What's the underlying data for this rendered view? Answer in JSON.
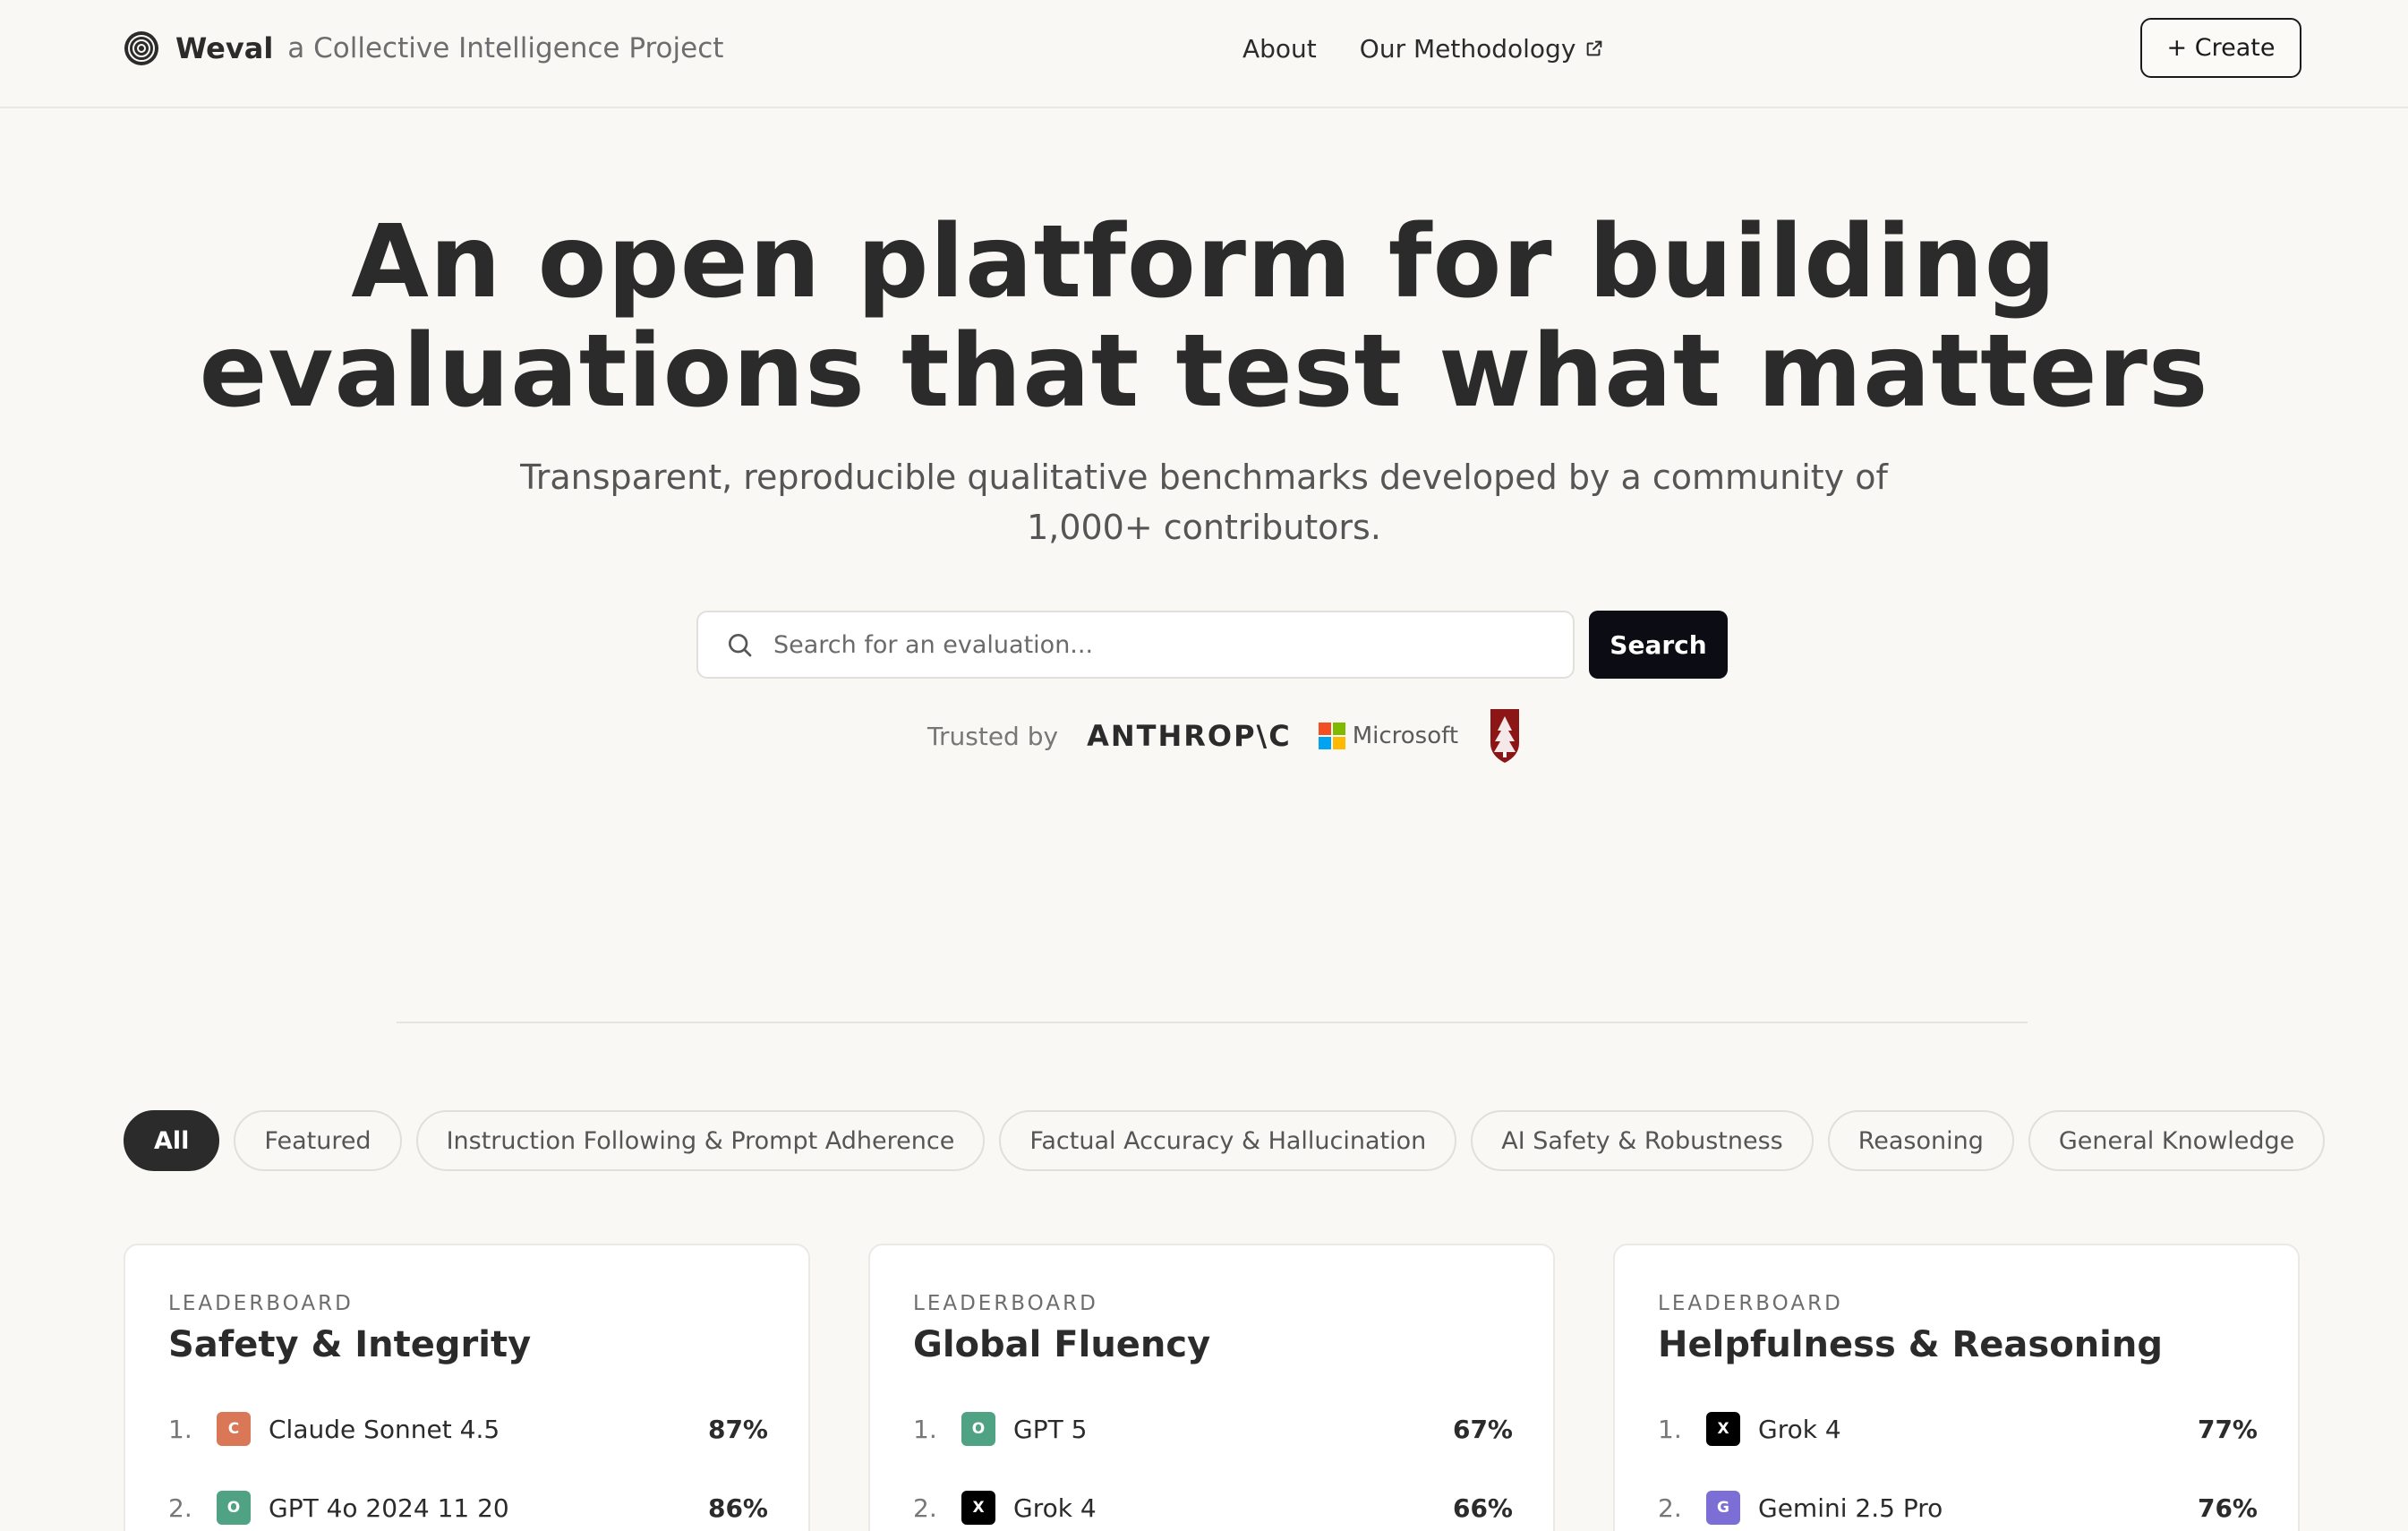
{
  "header": {
    "brand_name": "Weval",
    "brand_tagline": "a Collective Intelligence Project",
    "nav": [
      {
        "label": "About"
      },
      {
        "label": "Our Methodology"
      }
    ],
    "create_label": "+ Create"
  },
  "hero": {
    "title_line1": "An open platform for building",
    "title_line2": "evaluations that test what matters",
    "subtitle": "Transparent, reproducible qualitative benchmarks developed by a community of 1,000+ contributors."
  },
  "search": {
    "placeholder": "Search for an evaluation...",
    "button_label": "Search"
  },
  "trusted": {
    "label": "Trusted by",
    "anthropic": "ANTHROP\\C",
    "microsoft": "Microsoft",
    "microsoft_colors": [
      "#f25022",
      "#7fba00",
      "#00a4ef",
      "#ffb900"
    ],
    "stanford_color": "#8c1515"
  },
  "filters": [
    {
      "label": "All",
      "active": true
    },
    {
      "label": "Featured"
    },
    {
      "label": "Instruction Following & Prompt Adherence"
    },
    {
      "label": "Factual Accuracy & Hallucination"
    },
    {
      "label": "AI Safety & Robustness"
    },
    {
      "label": "Reasoning"
    },
    {
      "label": "General Knowledge"
    }
  ],
  "leaderboards": [
    {
      "eyebrow": "LEADERBOARD",
      "title": "Safety & Integrity",
      "rows": [
        {
          "rank": "1.",
          "badge": "C",
          "badge_color": "#d97757",
          "name": "Claude Sonnet 4.5",
          "score": "87%"
        },
        {
          "rank": "2.",
          "badge": "O",
          "badge_color": "#4fa284",
          "name": "GPT 4o 2024 11 20",
          "score": "86%"
        }
      ]
    },
    {
      "eyebrow": "LEADERBOARD",
      "title": "Global Fluency",
      "rows": [
        {
          "rank": "1.",
          "badge": "O",
          "badge_color": "#4fa284",
          "name": "GPT 5",
          "score": "67%"
        },
        {
          "rank": "2.",
          "badge": "X",
          "badge_color": "#000000",
          "name": "Grok 4",
          "score": "66%"
        }
      ]
    },
    {
      "eyebrow": "LEADERBOARD",
      "title": "Helpfulness & Reasoning",
      "rows": [
        {
          "rank": "1.",
          "badge": "X",
          "badge_color": "#000000",
          "name": "Grok 4",
          "score": "77%"
        },
        {
          "rank": "2.",
          "badge": "G",
          "badge_color": "#7b6fd6",
          "name": "Gemini 2.5 Pro",
          "score": "76%"
        }
      ]
    }
  ]
}
